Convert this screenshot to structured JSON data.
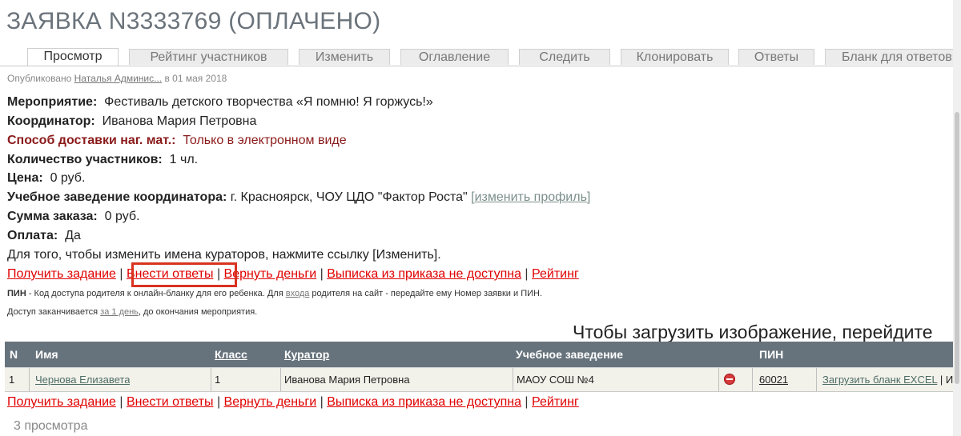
{
  "title": "ЗАЯВКА N3333769 (ОПЛАЧЕНО)",
  "tabs": [
    {
      "label": "Просмотр",
      "active": true
    },
    {
      "label": "Рейтинг участников"
    },
    {
      "label": "Изменить"
    },
    {
      "label": "Оглавление"
    },
    {
      "label": "Следить"
    },
    {
      "label": "Клонировать"
    },
    {
      "label": "Ответы"
    },
    {
      "label": "Бланк для ответов"
    }
  ],
  "published": {
    "prefix": "Опубликовано",
    "author": "Наталья Админис...",
    "date": "в 01 мая 2018"
  },
  "info": {
    "event_label": "Мероприятие:",
    "event_value": "Фестиваль детского творчества «Я помню! Я горжусь!»",
    "coordinator_label": "Координатор:",
    "coordinator_value": "Иванова Мария Петровна",
    "delivery_label": "Способ доставки наг. мат.:",
    "delivery_value": "Только в электронном виде",
    "participants_label": "Количество участников:",
    "participants_value": "1 чл.",
    "price_label": "Цена:",
    "price_value": "0 руб.",
    "school_label": "Учебное заведение координатора:",
    "school_value": "г. Красноярск, ЧОУ ЦДО \"Фактор Роста\"",
    "change_profile": "изменить профиль",
    "sum_label": "Сумма заказа:",
    "sum_value": "0 руб.",
    "payment_label": "Оплата:",
    "payment_value": "Да",
    "curators_note": "Для того, чтобы изменить имена кураторов, нажмите ссылку [Изменить]."
  },
  "actions": {
    "get_task": "Получить задание",
    "enter_answers": "Внести ответы",
    "refund": "Вернуть деньги",
    "extract": "Выписка из приказа не доступна",
    "rating": "Рейтинг",
    "separator": "|"
  },
  "pin_note": {
    "pin_label": "ПИН",
    "text1": " - Код доступа родителя к онлайн-бланку для его ребенка. Для ",
    "login_link": "входа",
    "text2": " родителя на сайт - передайте ему Номер заявки и ПИН."
  },
  "access_note": {
    "text1": "Доступ заканчивается ",
    "link": "за 1 день",
    "text2": ", до окончания мероприятия."
  },
  "upload_msg": "Чтобы загрузить изображение, перейдите",
  "table": {
    "headers": {
      "n": "N",
      "name": "Имя",
      "class": "Класс",
      "curator": "Куратор",
      "school": "Учебное заведение",
      "pin": "ПИН"
    },
    "rows": [
      {
        "n": "1",
        "name": "Чернова Елизавета",
        "class": "1",
        "curator": "Иванова Мария Петровна",
        "school": "МАОУ СОШ №4",
        "pin": "60021",
        "upload": "Загрузить бланк EXCEL",
        "more": "| И"
      }
    ]
  },
  "views": "3 просмотра"
}
